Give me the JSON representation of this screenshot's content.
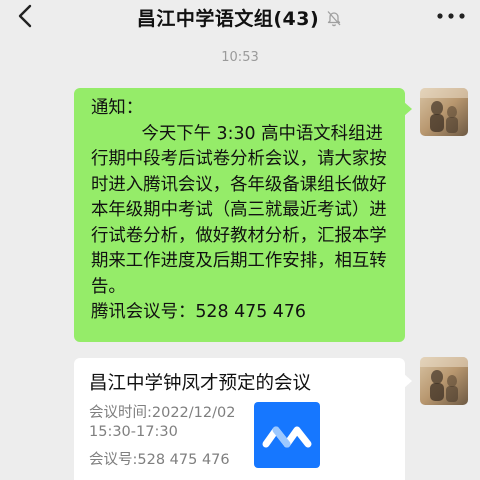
{
  "header": {
    "title": "昌江中学语文组(43)",
    "back_icon": "chevron-left-icon",
    "mute_icon": "bell-slash-icon",
    "more_icon": "more-dots-icon"
  },
  "timestamp": "10:53",
  "message": {
    "heading": "通知：",
    "body": "今天下午 3:30 高中语文科组进行期中段考后试卷分析会议，请大家按时进入腾讯会议，各年级备课组长做好本年级期中考试（高三就最近考试）进行试卷分析，做好教材分析，汇报本学期来工作进度及后期工作安排，相互转告。",
    "meeting_id_line": "腾讯会议号：528  475  476",
    "bubble_color": "#95ec69"
  },
  "card": {
    "title": "昌江中学钟凤才预定的会议",
    "time_label": "会议时间:2022/12/02",
    "time_range": "15:30-17:30",
    "meeting_no": "会议号:528 475 476",
    "logo_icon": "tencent-meeting-logo-icon",
    "logo_color": "#1677ff"
  }
}
